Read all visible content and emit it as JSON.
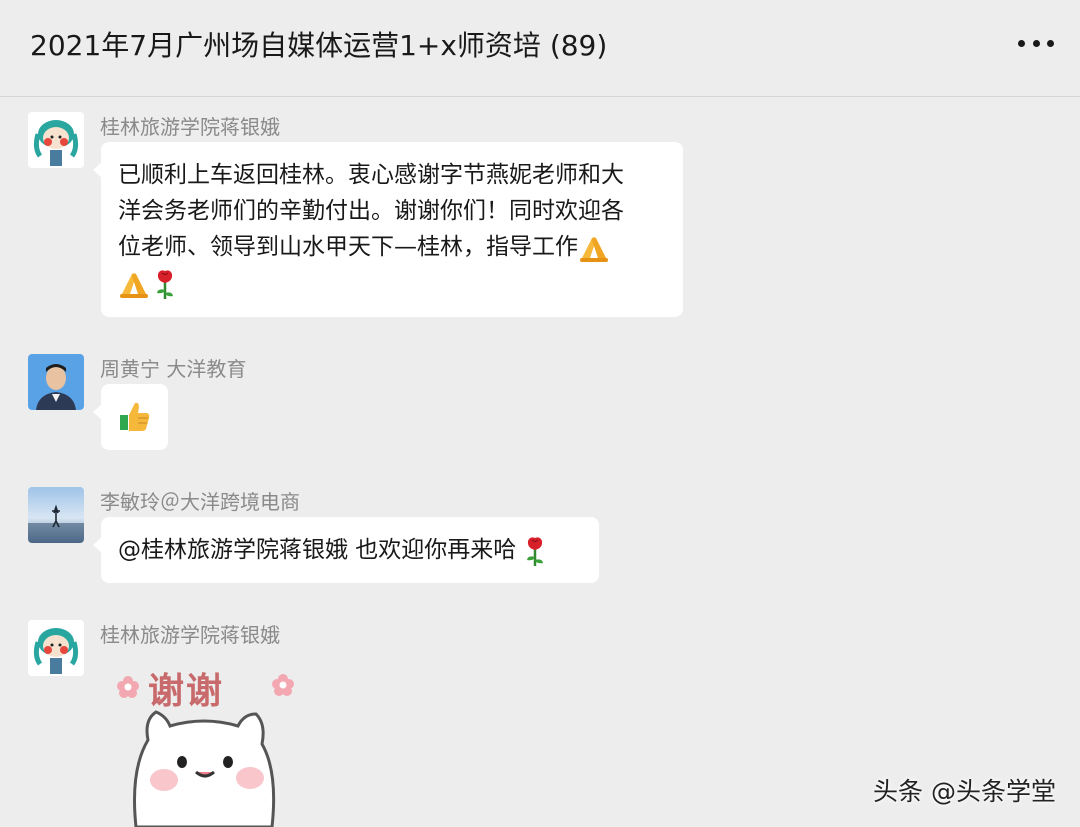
{
  "header": {
    "title": "2021年7月广州场自媒体运营1+x师资培 (89)"
  },
  "messages": [
    {
      "sender": "桂林旅游学院蒋银娥",
      "lines": [
        "已顺利上车返回桂林。衷心感谢字节燕妮老师和大",
        "洋会务老师们的辛勤付出。谢谢你们！同时欢迎各",
        "位老师、领导到山水甲天下—桂林，指导工作"
      ],
      "emojis": [
        "folded-hands",
        "folded-hands",
        "rose"
      ]
    },
    {
      "sender": "周黄宁 大洋教育",
      "emojis": [
        "thumbs-up"
      ]
    },
    {
      "sender": "李敏玲＠大洋跨境电商",
      "text": "@桂林旅游学院蒋银娥 也欢迎你再来哈",
      "emojis": [
        "rose"
      ]
    },
    {
      "sender": "桂林旅游学院蒋银娥",
      "sticker": {
        "text": "谢谢",
        "name": "cat-thank-you-sticker"
      }
    }
  ],
  "watermark": "头条 @头条学堂",
  "colors": {
    "background": "#ededed",
    "bubble": "#ffffff",
    "sender": "#8a8a8a",
    "sticker_text": "#c8696b"
  }
}
